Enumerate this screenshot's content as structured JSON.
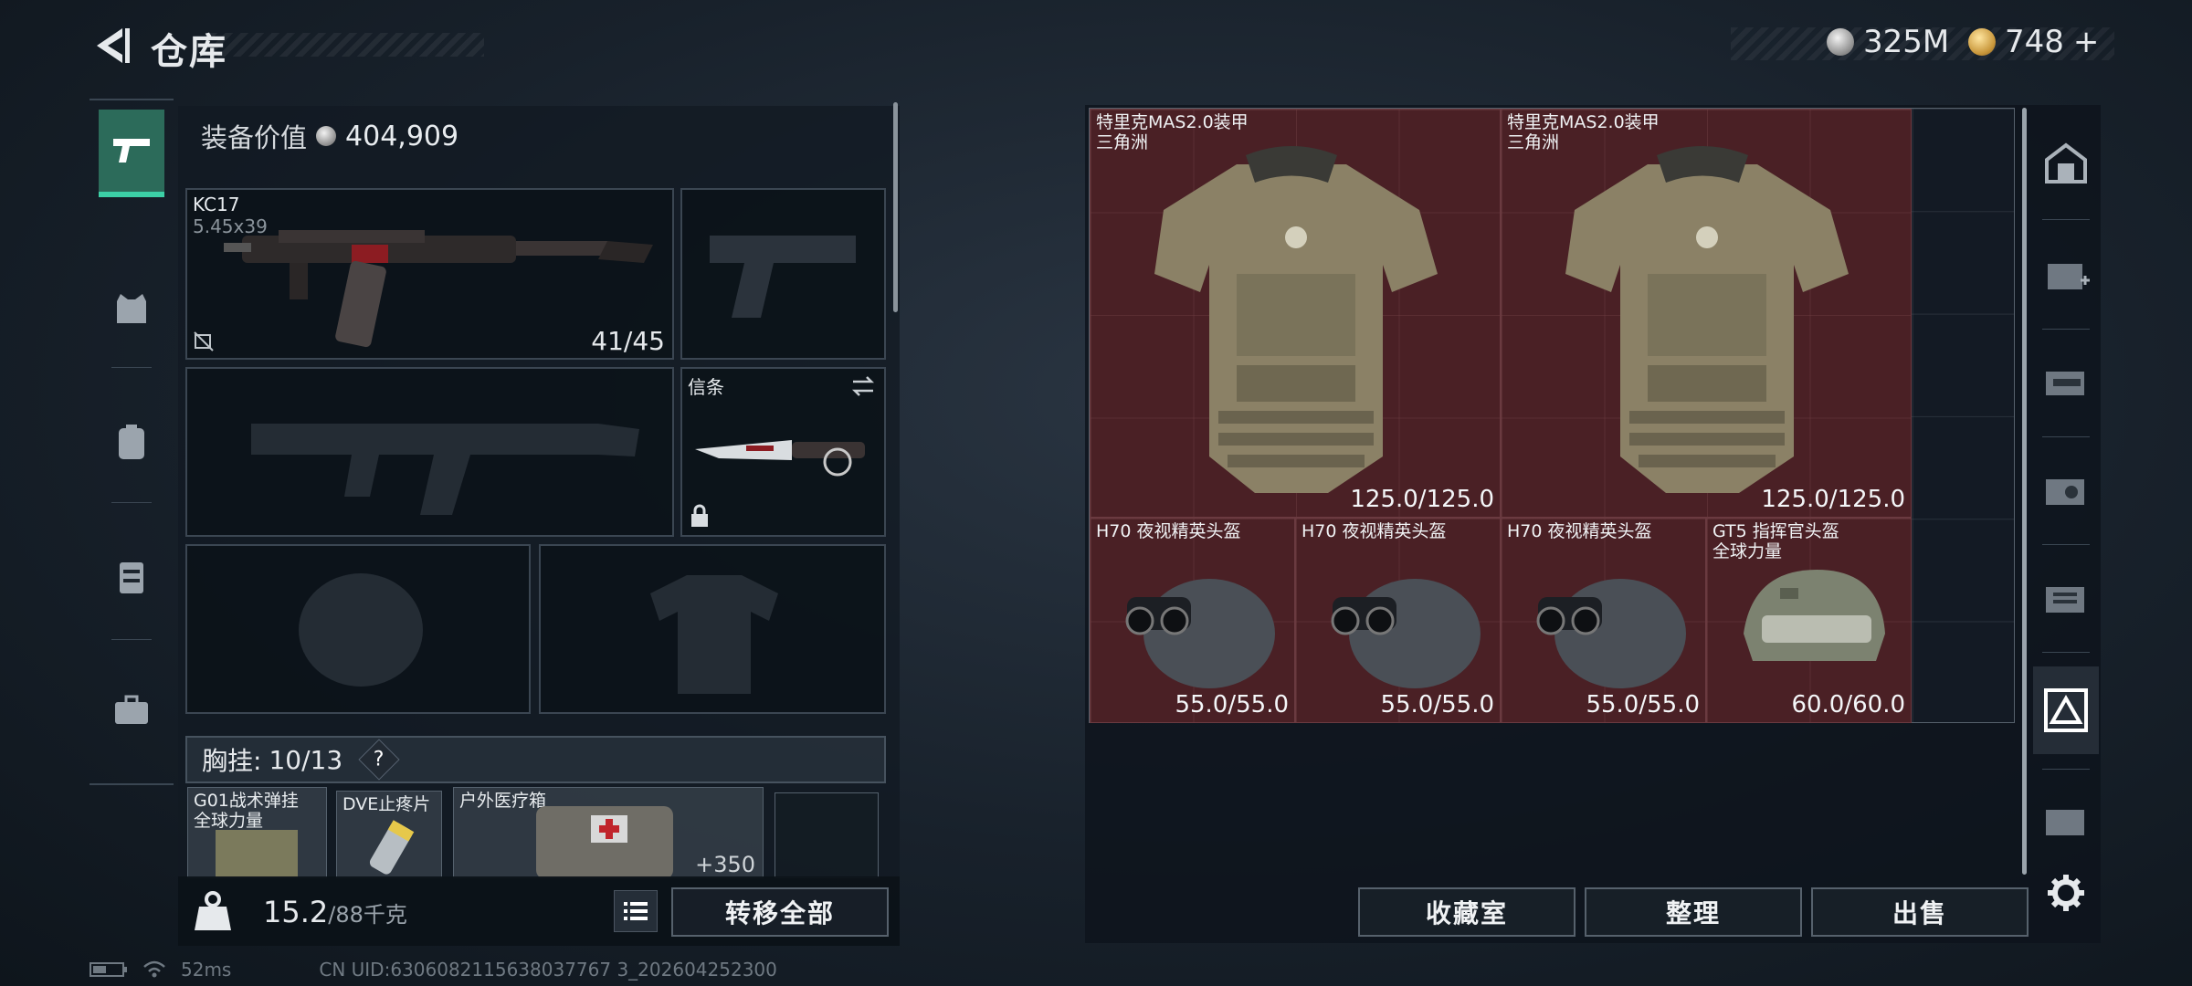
{
  "header": {
    "title": "仓库",
    "currency_silver": "325M",
    "currency_gold": "748",
    "gold_add": "+"
  },
  "left": {
    "equip_value_label": "装备价值",
    "equip_value": "404,909",
    "primary_weapon": {
      "name": "KC17",
      "ammo": "5.45x39",
      "count": "41/45"
    },
    "melee": {
      "name": "信条"
    },
    "chest_rig": {
      "label": "胸挂:",
      "value": "10/13",
      "help": "?"
    },
    "chest_items": [
      {
        "name": "G01战术弹挂",
        "sub": "全球力量"
      },
      {
        "name": "DVE止疼片"
      },
      {
        "name": "户外医疗箱",
        "value": "+350"
      }
    ],
    "weight": "15.2",
    "weight_max": "/88千克",
    "transfer_all": "转移全部"
  },
  "stash": {
    "items": [
      {
        "name": "特里克MAS2.0装甲",
        "sub": "三角洲",
        "durability": "125.0/125.0"
      },
      {
        "name": "特里克MAS2.0装甲",
        "sub": "三角洲",
        "durability": "125.0/125.0"
      },
      {
        "name": "H70 夜视精英头盔",
        "durability": "55.0/55.0"
      },
      {
        "name": "H70 夜视精英头盔",
        "durability": "55.0/55.0"
      },
      {
        "name": "H70 夜视精英头盔",
        "durability": "55.0/55.0"
      },
      {
        "name": "GT5 指挥官头盔",
        "sub": "全球力量",
        "durability": "60.0/60.0"
      }
    ],
    "buttons": {
      "collection": "收藏室",
      "sort": "整理",
      "sell": "出售"
    }
  },
  "status": {
    "ping": "52ms",
    "uid": "CN UID:6306082115638037767 3_202604252300"
  },
  "colors": {
    "accent": "#3cd0a6",
    "item_bg": "#4a2025"
  }
}
